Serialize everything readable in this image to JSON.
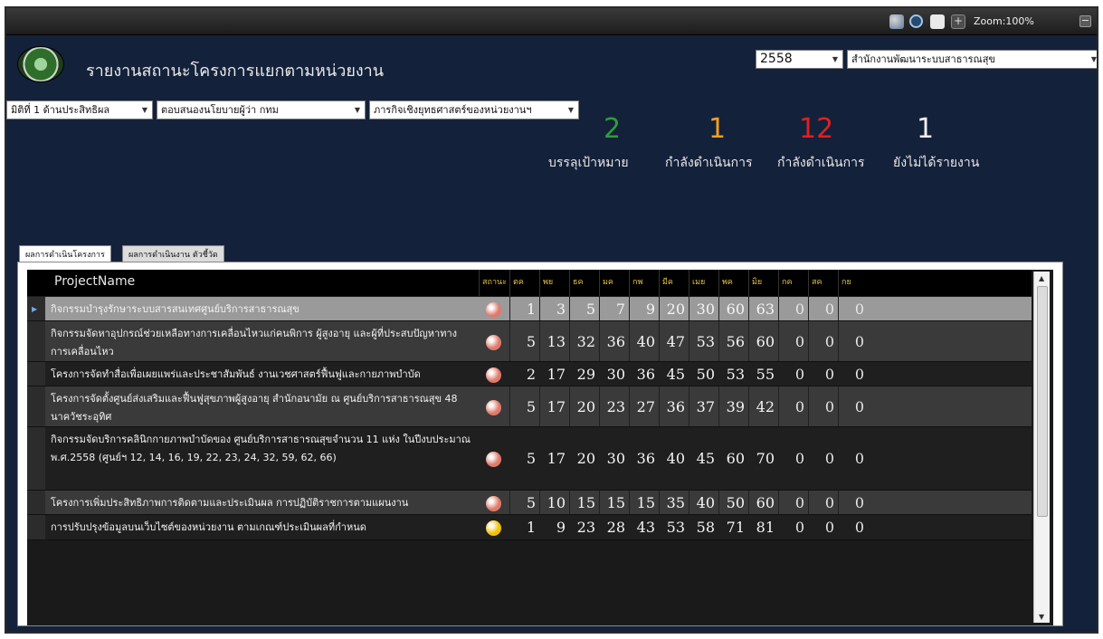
{
  "toolbar": {
    "zoom_label": "Zoom:100%",
    "plus": "+",
    "minus": "−"
  },
  "header": {
    "title": "รายงานสถานะโครงการแยกตามหน่วยงาน",
    "year": "2558",
    "org": "สำนักงานพัฒนาระบบสาธารณสุข"
  },
  "filters": {
    "dimension": "มิติที่ 1 ด้านประสิทธิผล",
    "policy": "ตอบสนองนโยบายผู้ว่า กทม",
    "mission": "ภารกิจเชิงยุทธศาสตร์ของหน่วยงานฯ"
  },
  "stats": [
    {
      "value": "2",
      "label": "บรรลุเป้าหมาย",
      "color": "#2e9e3a"
    },
    {
      "value": "1",
      "label": "กำลังดำเนินการ",
      "color": "#f0a020"
    },
    {
      "value": "12",
      "label": "กำลังดำเนินการ",
      "color": "#e02020"
    },
    {
      "value": "1",
      "label": "ยังไม่ได้รายงาน",
      "color": "#f0f0f0"
    }
  ],
  "tabs": {
    "project": "ผลการดำเนินโครงการ",
    "indicator": "ผลการดำเนินงาน ตัวชี้วัด"
  },
  "grid": {
    "headers": {
      "project": "ProjectName",
      "status": "สถานะ",
      "months": [
        "ตค",
        "พย",
        "ธค",
        "มค",
        "กพ",
        "มีค",
        "เมย",
        "พค",
        "มิย",
        "กค",
        "สค",
        "กย"
      ]
    },
    "rows": [
      {
        "name": "กิจกรรมบำรุงรักษาระบบสารสนเทศศูนย์บริการสาธารณสุข",
        "status_color": "#e07a6a",
        "values": [
          "1",
          "3",
          "5",
          "7",
          "9",
          "20",
          "30",
          "60",
          "63",
          "0",
          "0",
          "0"
        ]
      },
      {
        "name": "กิจกรรมจัดหาอุปกรณ์ช่วยเหลือทางการเคลื่อนไหวแก่คนพิการ ผู้สูงอายุ และผู้ที่ประสบปัญหาทาง การเคลื่อนไหว",
        "status_color": "#e07a6a",
        "values": [
          "5",
          "13",
          "32",
          "36",
          "40",
          "47",
          "53",
          "56",
          "60",
          "0",
          "0",
          "0"
        ]
      },
      {
        "name": "โครงการจัดทำสื่อเพื่อเผยแพร่และประชาสัมพันธ์ งานเวชศาสตร์ฟื้นฟูและกายภาพบำบัด",
        "status_color": "#e07a6a",
        "values": [
          "2",
          "17",
          "29",
          "30",
          "36",
          "45",
          "50",
          "53",
          "55",
          "0",
          "0",
          "0"
        ]
      },
      {
        "name": "โครงการจัดตั้งศูนย์ส่งเสริมและฟื้นฟูสุขภาพผู้สูงอายุ สำนักอนามัย ณ ศูนย์บริการสาธารณสุข 48 นาควัชระอุทิศ",
        "status_color": "#e07a6a",
        "values": [
          "5",
          "17",
          "20",
          "23",
          "27",
          "36",
          "37",
          "39",
          "42",
          "0",
          "0",
          "0"
        ]
      },
      {
        "name": "กิจกรรมจัดบริการคลินิกกายภาพบำบัดของ ศูนย์บริการสาธารณสุขจำนวน 11 แห่ง ในปีงบประมาณ พ.ศ.2558 (ศูนย์ฯ 12, 14, 16, 19, 22, 23, 24, 32, 59, 62, 66)",
        "status_color": "#e07a6a",
        "values": [
          "5",
          "17",
          "20",
          "30",
          "36",
          "40",
          "45",
          "60",
          "70",
          "0",
          "0",
          "0"
        ]
      },
      {
        "name": "โครงการเพิ่มประสิทธิภาพการติดตามและประเมินผล การปฏิบัติราชการตามแผนงาน",
        "status_color": "#e07a6a",
        "values": [
          "5",
          "10",
          "15",
          "15",
          "15",
          "35",
          "40",
          "50",
          "60",
          "0",
          "0",
          "0"
        ]
      },
      {
        "name": "การปรับปรุงข้อมูลบนเว็บไซต์ของหน่วยงาน ตามเกณฑ์ประเมินผลที่กำหนด",
        "status_color": "#f2c200",
        "values": [
          "1",
          "9",
          "23",
          "28",
          "43",
          "53",
          "58",
          "71",
          "81",
          "0",
          "0",
          "0"
        ]
      }
    ]
  }
}
